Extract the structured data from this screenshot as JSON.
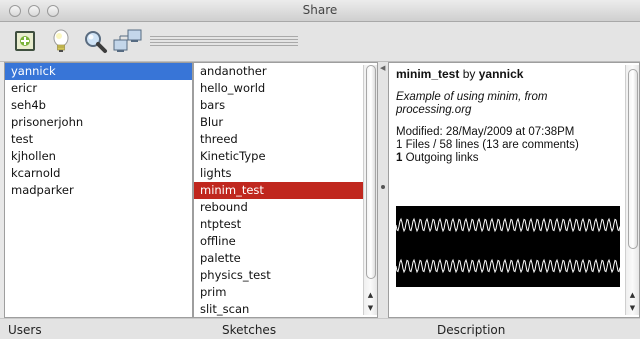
{
  "window": {
    "title": "Share"
  },
  "toolbar": {
    "icons": [
      "export-icon",
      "lightbulb-icon",
      "magnifier-icon",
      "network-icon"
    ]
  },
  "users": {
    "selected_index": 0,
    "items": [
      "yannick",
      "ericr",
      "seh4b",
      "prisonerjohn",
      "test",
      "kjhollen",
      "kcarnold",
      "madparker"
    ]
  },
  "sketches": {
    "selected_index": 7,
    "items": [
      "andanother",
      "hello_world",
      "bars",
      "Blur",
      "threed",
      "KineticType",
      "lights",
      "minim_test",
      "rebound",
      "ntptest",
      "offline",
      "palette",
      "physics_test",
      "prim",
      "slit_scan"
    ]
  },
  "description": {
    "sketch_name": "minim_test",
    "by_label": "by",
    "author": "yannick",
    "summary": "Example of using minim, from processing.org",
    "modified": "Modified: 28/May/2009 at 07:38PM",
    "files": "1 Files / 58 lines (13 are comments)",
    "outgoing_count": "1",
    "outgoing_label": "Outgoing links"
  },
  "footer": {
    "users_label": "Users",
    "sketches_label": "Sketches",
    "description_label": "Description"
  },
  "colors": {
    "selection_blue": "#3875d7",
    "selection_red": "#c0271e",
    "preview_bg": "#000000",
    "wave": "#ffffff"
  }
}
